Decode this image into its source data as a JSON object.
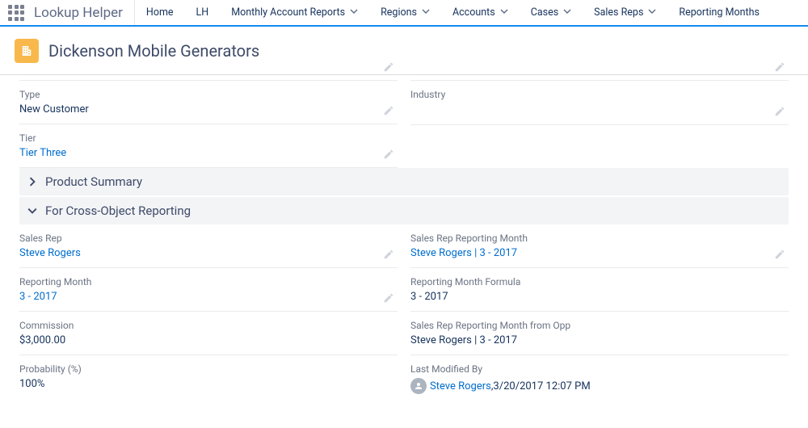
{
  "app": {
    "name": "Lookup Helper"
  },
  "nav": [
    {
      "label": "Home",
      "has_menu": false
    },
    {
      "label": "LH",
      "has_menu": false
    },
    {
      "label": "Monthly Account Reports",
      "has_menu": true
    },
    {
      "label": "Regions",
      "has_menu": true
    },
    {
      "label": "Accounts",
      "has_menu": true
    },
    {
      "label": "Cases",
      "has_menu": true
    },
    {
      "label": "Sales Reps",
      "has_menu": true
    },
    {
      "label": "Reporting Months",
      "has_menu": true
    }
  ],
  "record": {
    "title": "Dickenson Mobile Generators"
  },
  "fields_top_left": [
    {
      "label": "Type",
      "value": "New Customer",
      "link": false,
      "editable": true
    },
    {
      "label": "Tier",
      "value": "Tier Three",
      "link": true,
      "editable": true
    }
  ],
  "fields_top_right": [
    {
      "label": "Industry",
      "value": "",
      "link": false,
      "editable": true
    }
  ],
  "sections": {
    "product_summary": {
      "title": "Product Summary",
      "expanded": false
    },
    "cross_object": {
      "title": "For Cross-Object Reporting",
      "expanded": true
    }
  },
  "cross_left": [
    {
      "label": "Sales Rep",
      "value": "Steve Rogers",
      "link": true,
      "editable": true
    },
    {
      "label": "Reporting Month",
      "value": "3 - 2017",
      "link": true,
      "editable": true
    },
    {
      "label": "Commission",
      "value": "$3,000.00",
      "link": false,
      "editable": false
    },
    {
      "label": "Probability (%)",
      "value": "100%",
      "link": false,
      "editable": false
    }
  ],
  "cross_right": [
    {
      "label": "Sales Rep Reporting Month",
      "value": "Steve Rogers | 3 - 2017",
      "link": true,
      "editable": true
    },
    {
      "label": "Reporting Month Formula",
      "value": "3 - 2017",
      "link": false,
      "editable": false
    },
    {
      "label": "Sales Rep Reporting Month from Opp",
      "value": "Steve Rogers | 3 - 2017",
      "link": false,
      "editable": false
    }
  ],
  "last_modified": {
    "label": "Last Modified By",
    "user": "Steve Rogers",
    "sep": ", ",
    "datetime": "3/20/2017 12:07 PM"
  }
}
